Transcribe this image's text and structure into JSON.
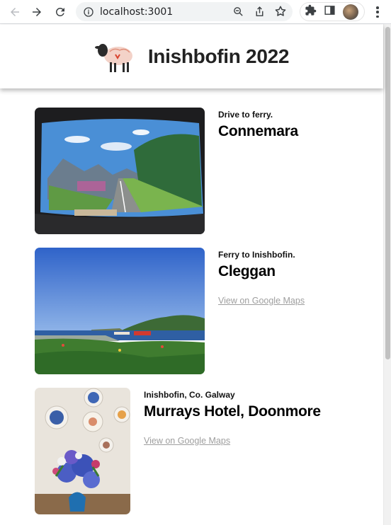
{
  "browser": {
    "url": "localhost:3001"
  },
  "header": {
    "title": "Inishbofin 2022"
  },
  "entries": [
    {
      "subtitle": "Drive to ferry.",
      "title": "Connemara",
      "link": ""
    },
    {
      "subtitle": "Ferry to Inishbofin.",
      "title": "Cleggan",
      "link": "View on Google Maps"
    },
    {
      "subtitle": "Inishbofin, Co. Galway",
      "title": "Murrays Hotel, Doonmore",
      "link": "View on Google Maps"
    }
  ]
}
